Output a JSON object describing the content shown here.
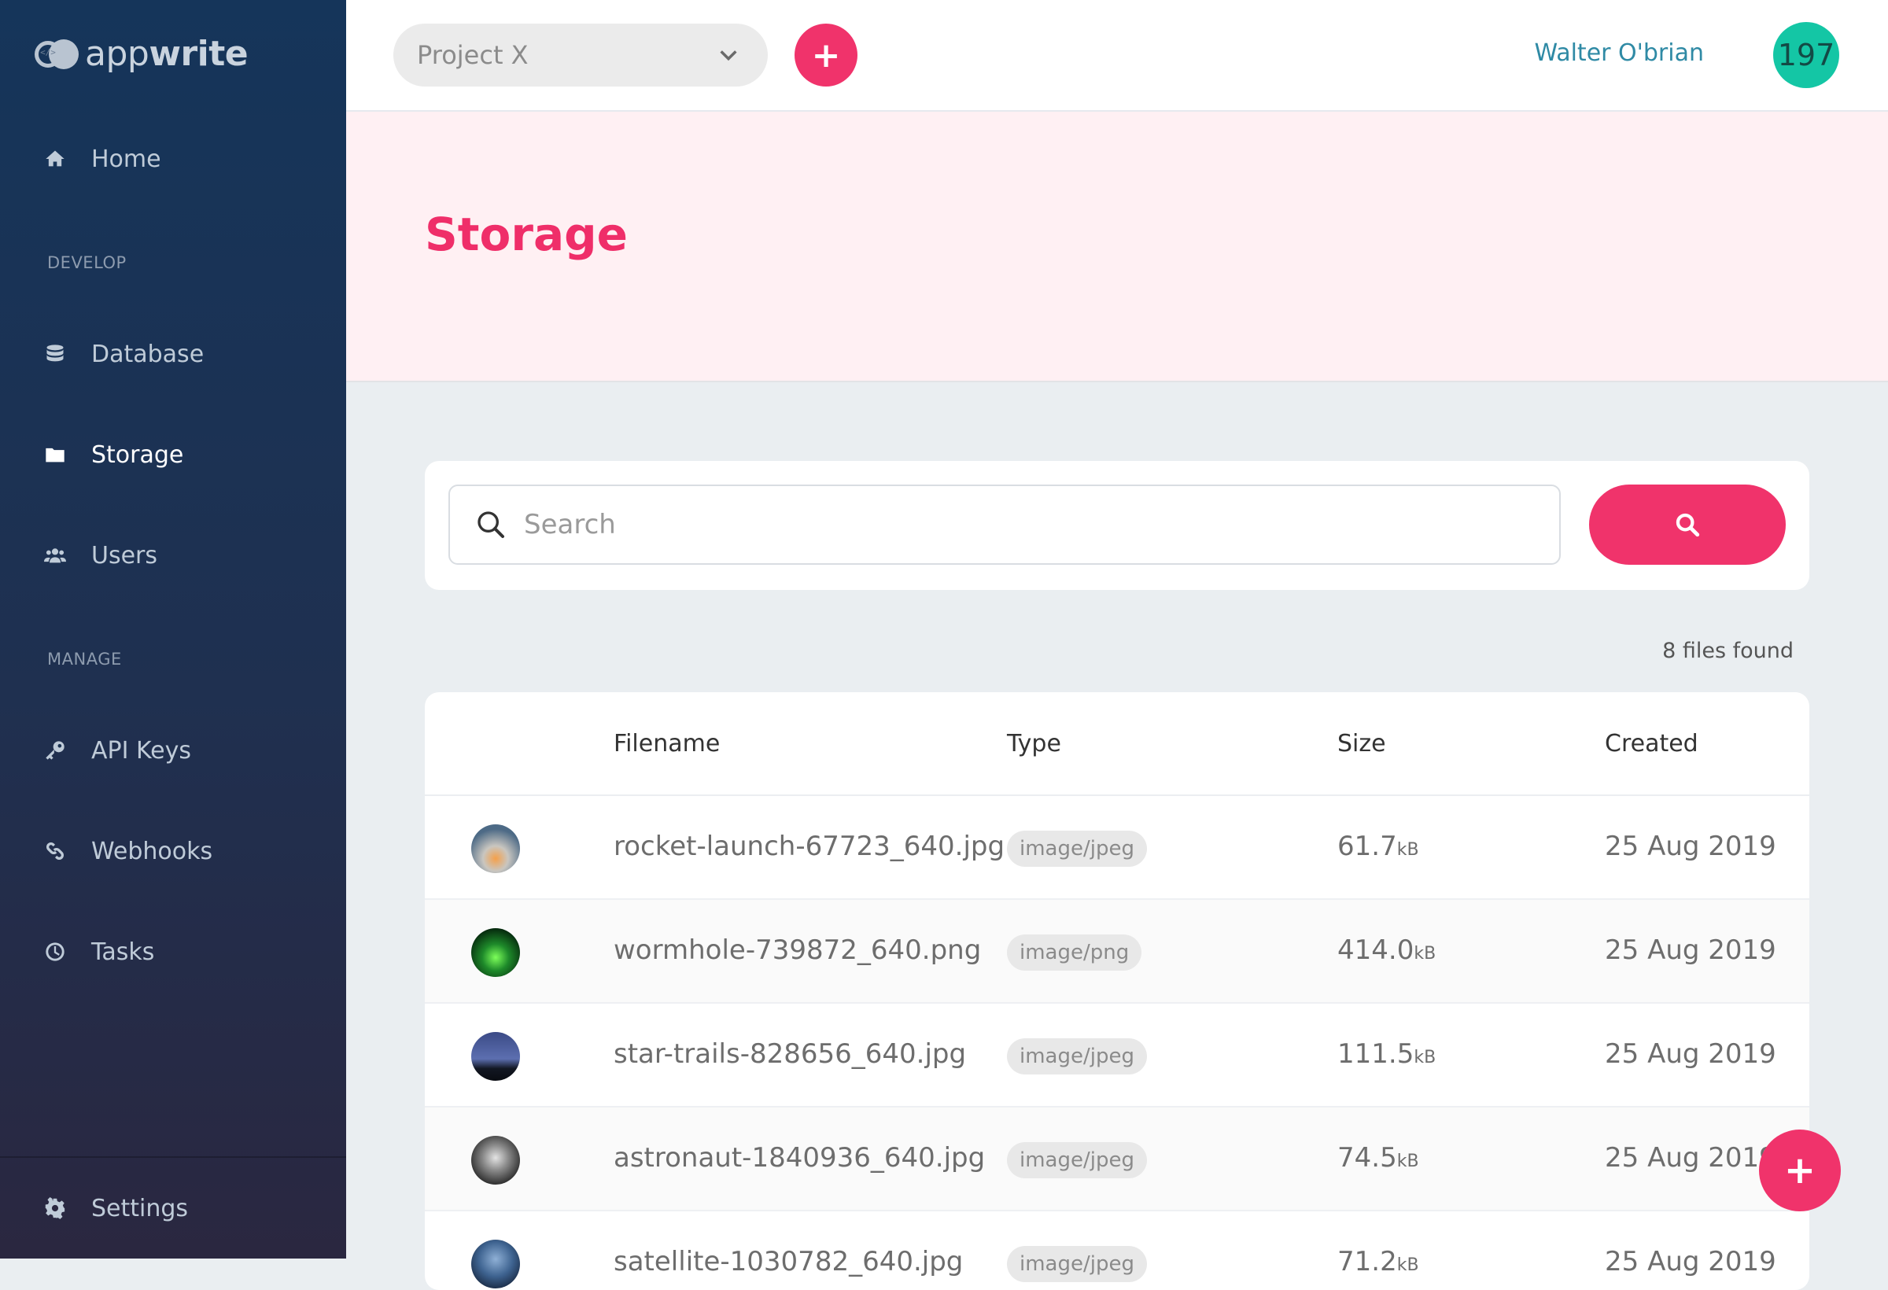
{
  "sidebar": {
    "logo_light": "app",
    "logo_bold": "write",
    "home": "Home",
    "section_develop": "DEVELOP",
    "database": "Database",
    "storage": "Storage",
    "users": "Users",
    "section_manage": "MANAGE",
    "api_keys": "API Keys",
    "webhooks": "Webhooks",
    "tasks": "Tasks",
    "settings": "Settings"
  },
  "header": {
    "project": "Project X",
    "add_label": "+",
    "user_name": "Walter O'brian",
    "avatar_text": "197"
  },
  "page": {
    "title": "Storage"
  },
  "search": {
    "placeholder": "Search"
  },
  "files_found": "8 files found",
  "table": {
    "headers": {
      "filename": "Filename",
      "type": "Type",
      "size": "Size",
      "created": "Created"
    },
    "rows": [
      {
        "filename": "rocket-launch-67723_640.jpg",
        "type": "image/jpeg",
        "size": "61.7",
        "unit": "kB",
        "created": "25 Aug 2019"
      },
      {
        "filename": "wormhole-739872_640.png",
        "type": "image/png",
        "size": "414.0",
        "unit": "kB",
        "created": "25 Aug 2019"
      },
      {
        "filename": "star-trails-828656_640.jpg",
        "type": "image/jpeg",
        "size": "111.5",
        "unit": "kB",
        "created": "25 Aug 2019"
      },
      {
        "filename": "astronaut-1840936_640.jpg",
        "type": "image/jpeg",
        "size": "74.5",
        "unit": "kB",
        "created": "25 Aug 2019"
      },
      {
        "filename": "satellite-1030782_640.jpg",
        "type": "image/jpeg",
        "size": "71.2",
        "unit": "kB",
        "created": "25 Aug 2019"
      }
    ]
  },
  "fab_label": "+",
  "colors": {
    "accent": "#f0336b",
    "avatar": "#14c6a5",
    "sidebar_top": "#15355a",
    "sidebar_bottom": "#2a2740"
  },
  "icons": [
    "home-icon",
    "database-icon",
    "folder-icon",
    "users-icon",
    "key-icon",
    "link-icon",
    "clock-icon",
    "gear-icon",
    "search-icon",
    "chevron-down-icon",
    "plus-icon"
  ]
}
